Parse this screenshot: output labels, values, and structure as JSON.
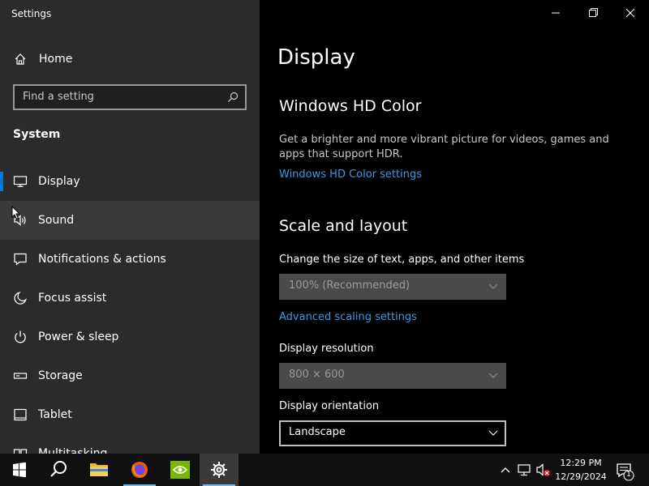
{
  "window": {
    "title": "Settings"
  },
  "sidebar": {
    "home_label": "Home",
    "search_placeholder": "Find a setting",
    "section_label": "System",
    "items": [
      {
        "label": "Display",
        "icon": "monitor-icon"
      },
      {
        "label": "Sound",
        "icon": "speaker-icon"
      },
      {
        "label": "Notifications & actions",
        "icon": "notification-icon"
      },
      {
        "label": "Focus assist",
        "icon": "moon-icon"
      },
      {
        "label": "Power & sleep",
        "icon": "power-icon"
      },
      {
        "label": "Storage",
        "icon": "storage-icon"
      },
      {
        "label": "Tablet",
        "icon": "tablet-icon"
      },
      {
        "label": "Multitasking",
        "icon": "multitasking-icon"
      }
    ]
  },
  "main": {
    "title": "Display",
    "hd_color": {
      "heading": "Windows HD Color",
      "description": "Get a brighter and more vibrant picture for videos, games and apps that support HDR.",
      "link": "Windows HD Color settings"
    },
    "scale_layout": {
      "heading": "Scale and layout",
      "size_label": "Change the size of text, apps, and other items",
      "size_value": "100% (Recommended)",
      "advanced_link": "Advanced scaling settings",
      "resolution_label": "Display resolution",
      "resolution_value": "800 × 600",
      "orientation_label": "Display orientation",
      "orientation_value": "Landscape"
    }
  },
  "taskbar": {
    "time": "12:29 PM",
    "date": "12/29/2024",
    "notification_count": "1"
  },
  "colors": {
    "accent": "#0078d7",
    "link": "#3a9ae8",
    "sidebar_bg": "#2b2b2b"
  }
}
